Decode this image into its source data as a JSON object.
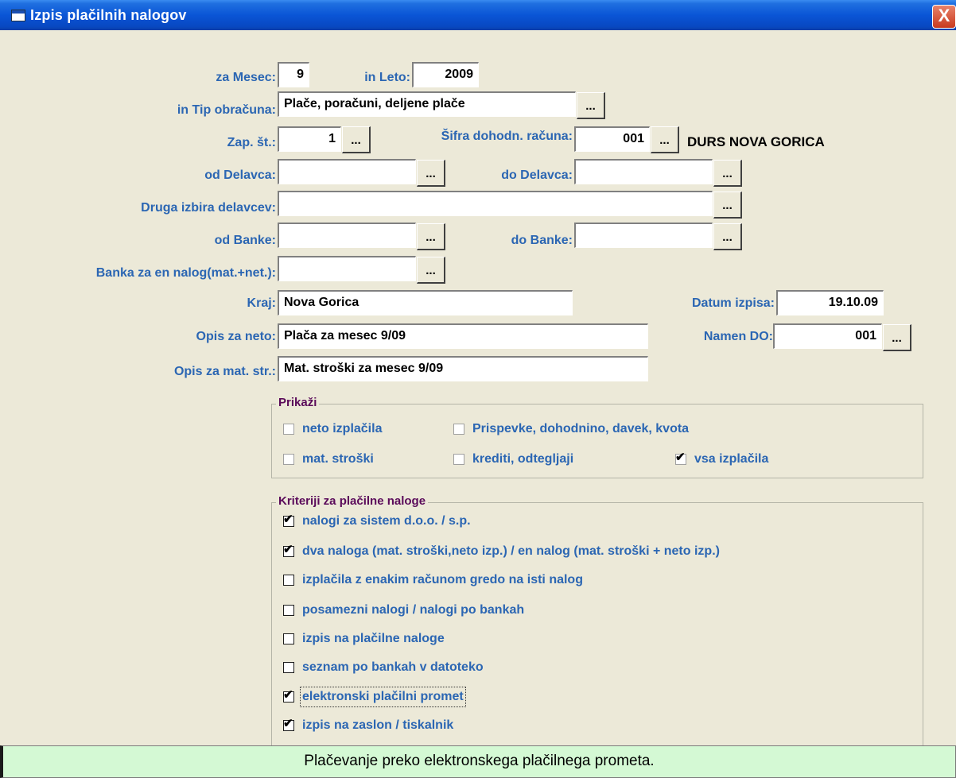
{
  "window": {
    "title": "Izpis plačilnih nalogov",
    "close_label": "X"
  },
  "form": {
    "mesec_label": "za Mesec:",
    "mesec_value": "9",
    "leto_label": "in Leto:",
    "leto_value": "2009",
    "tip_label": "in Tip obračuna:",
    "tip_value": "Plače, poračuni, deljene plače",
    "zap_label": "Zap. št.:",
    "zap_value": "1",
    "sifra_label": "Šifra dohodn. računa:",
    "sifra_value": "001",
    "sifra_desc": "DURS NOVA GORICA",
    "od_delavca_label": "od Delavca:",
    "od_delavca_value": "",
    "do_delavca_label": "do Delavca:",
    "do_delavca_value": "",
    "druga_label": "Druga izbira delavcev:",
    "druga_value": "",
    "od_banke_label": "od Banke:",
    "od_banke_value": "",
    "do_banke_label": "do Banke:",
    "do_banke_value": "",
    "banka_en_label": "Banka za en nalog(mat.+net.):",
    "banka_en_value": "",
    "kraj_label": "Kraj:",
    "kraj_value": "Nova Gorica",
    "datum_label": "Datum izpisa:",
    "datum_value": "19.10.09",
    "opis_neto_label": "Opis za neto:",
    "opis_neto_value": "Plača za mesec 9/09",
    "namen_label": "Namen DO:",
    "namen_value": "001",
    "opis_mat_label": "Opis za mat. str.:",
    "opis_mat_value": "Mat. stroški za mesec 9/09",
    "browse_label": "...",
    "check_mark": "✔"
  },
  "prikazi": {
    "title": "Prikaži",
    "items": [
      {
        "label": "neto izplačila",
        "checked": false
      },
      {
        "label": "Prispevke, dohodnino, davek, kvota",
        "checked": false
      },
      {
        "label": "mat. stroški",
        "checked": false
      },
      {
        "label": "krediti, odtegljaji",
        "checked": false
      },
      {
        "label": "vsa izplačila",
        "checked": true
      }
    ]
  },
  "kriteriji": {
    "title": "Kriteriji za plačilne naloge",
    "items": [
      {
        "label": "nalogi za sistem d.o.o. / s.p.",
        "checked": true
      },
      {
        "label": "dva naloga (mat. stroški,neto izp.) / en nalog (mat. stroški + neto izp.)",
        "checked": true
      },
      {
        "label": "izplačila z enakim računom gredo na isti nalog",
        "checked": false
      },
      {
        "label": "posamezni nalogi / nalogi po bankah",
        "checked": false
      },
      {
        "label": "izpis na plačilne naloge",
        "checked": false
      },
      {
        "label": "seznam po bankah v datoteko",
        "checked": false
      },
      {
        "label": "elektronski plačilni promet",
        "checked": true
      },
      {
        "label": "izpis na zaslon / tiskalnik",
        "checked": true
      }
    ]
  },
  "status": {
    "text": "Plačevanje preko elektronskega plačilnega prometa."
  },
  "colors": {
    "title_bar": "#0a55d6",
    "label_blue": "#2b66b3",
    "group_title": "#5a0a5a",
    "status_bg": "#d4f9d4",
    "window_bg": "#ece9d8"
  }
}
